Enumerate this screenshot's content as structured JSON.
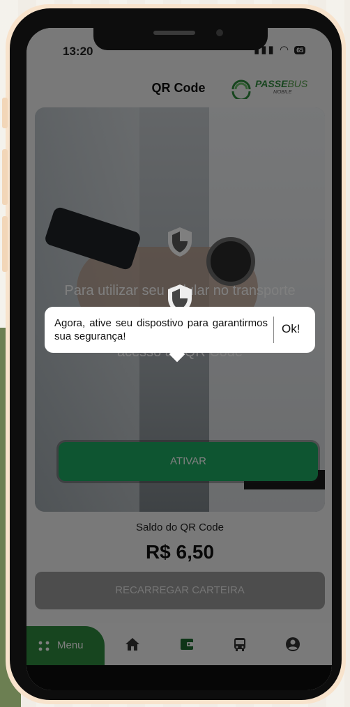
{
  "status": {
    "time": "13:20",
    "battery": "65"
  },
  "header": {
    "title": "QR Code",
    "logo_main": "PASSE",
    "logo_accent": "BUS",
    "logo_sub": "MOBILE"
  },
  "hero": {
    "message_line1": "Para utilizar seu celular no transporte",
    "message_line2": "acesso ao QR Code",
    "activate_label": "ATIVAR"
  },
  "balance": {
    "label": "Saldo do QR Code",
    "value": "R$ 6,50"
  },
  "recharge_label": "RECARREGAR CARTEIRA",
  "nav": {
    "menu_label": "Menu"
  },
  "tooltip": {
    "message": "Agora, ative seu dispostivo para garantirmos sua segurança!",
    "ok_label": "Ok!"
  },
  "colors": {
    "brand_green": "#1dab63",
    "menu_green": "#2f8a3e",
    "frame": "#f8e3cc"
  },
  "icons": [
    "shield-icon",
    "home-icon",
    "wallet-icon",
    "bus-icon",
    "user-icon",
    "grid-icon",
    "wifi-icon",
    "signal-icon"
  ]
}
